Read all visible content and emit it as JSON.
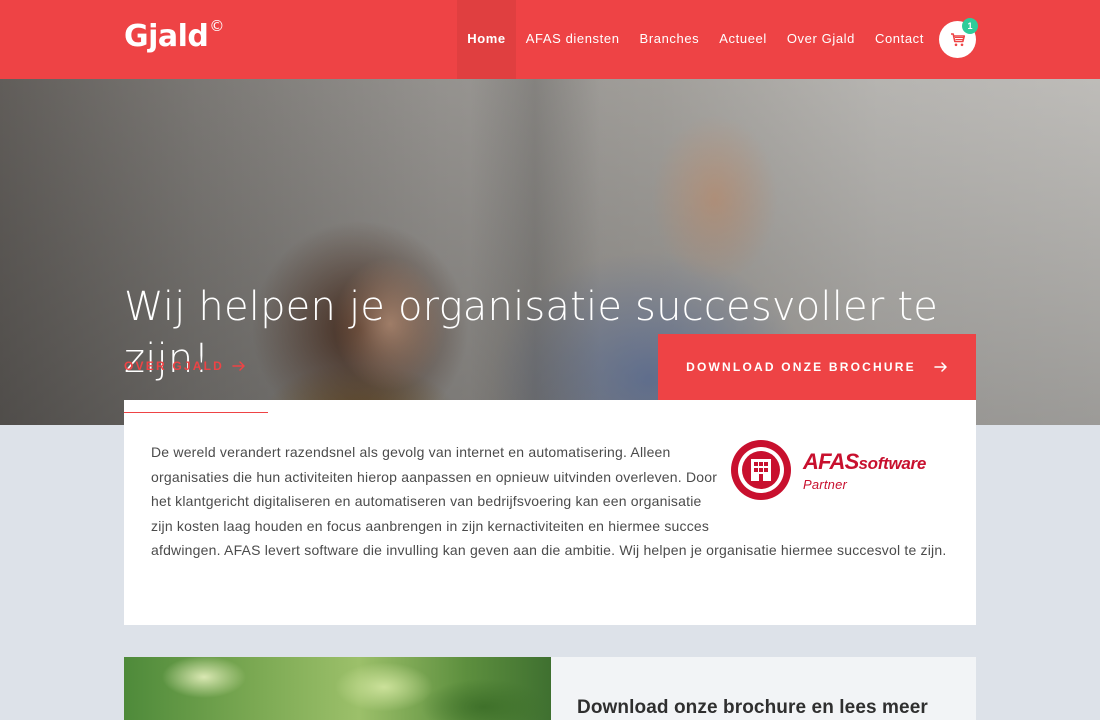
{
  "header": {
    "logo_text": "Gjald",
    "logo_mark": "©",
    "nav": [
      {
        "label": "Home",
        "active": true
      },
      {
        "label": "AFAS diensten",
        "active": false
      },
      {
        "label": "Branches",
        "active": false
      },
      {
        "label": "Actueel",
        "active": false
      },
      {
        "label": "Over Gjald",
        "active": false
      },
      {
        "label": "Contact",
        "active": false
      }
    ],
    "cart_count": "1",
    "cart_icon": "shopping-cart-icon"
  },
  "hero": {
    "title": "Wij helpen je organisatie succesvoller te zijn!",
    "over_link": "OVER GJALD",
    "brochure_button": "DOWNLOAD ONZE BROCHURE",
    "arrow_icon": "arrow-right-icon"
  },
  "intro": {
    "text": "De wereld verandert razendsnel als gevolg van internet en automatisering. Alleen organisaties die hun activiteiten hierop aanpassen en opnieuw uitvinden overleven. Door het klantgericht digitaliseren en automatiseren van bedrijfsvoering kan een organisatie zijn kosten laag houden en focus aanbrengen in zijn kernactiviteiten en hiermee succes afdwingen.  AFAS levert software die invulling kan geven aan die ambitie. Wij helpen je organisatie hiermee succesvol te zijn.",
    "afas_logo": {
      "brand": "AFAS",
      "brand_suffix": "software",
      "partner": "Partner"
    }
  },
  "bottom": {
    "heading": "Download onze brochure en lees meer"
  },
  "colors": {
    "accent": "#ee4345",
    "afas_red": "#c8102e",
    "badge": "#2ecc9a"
  }
}
